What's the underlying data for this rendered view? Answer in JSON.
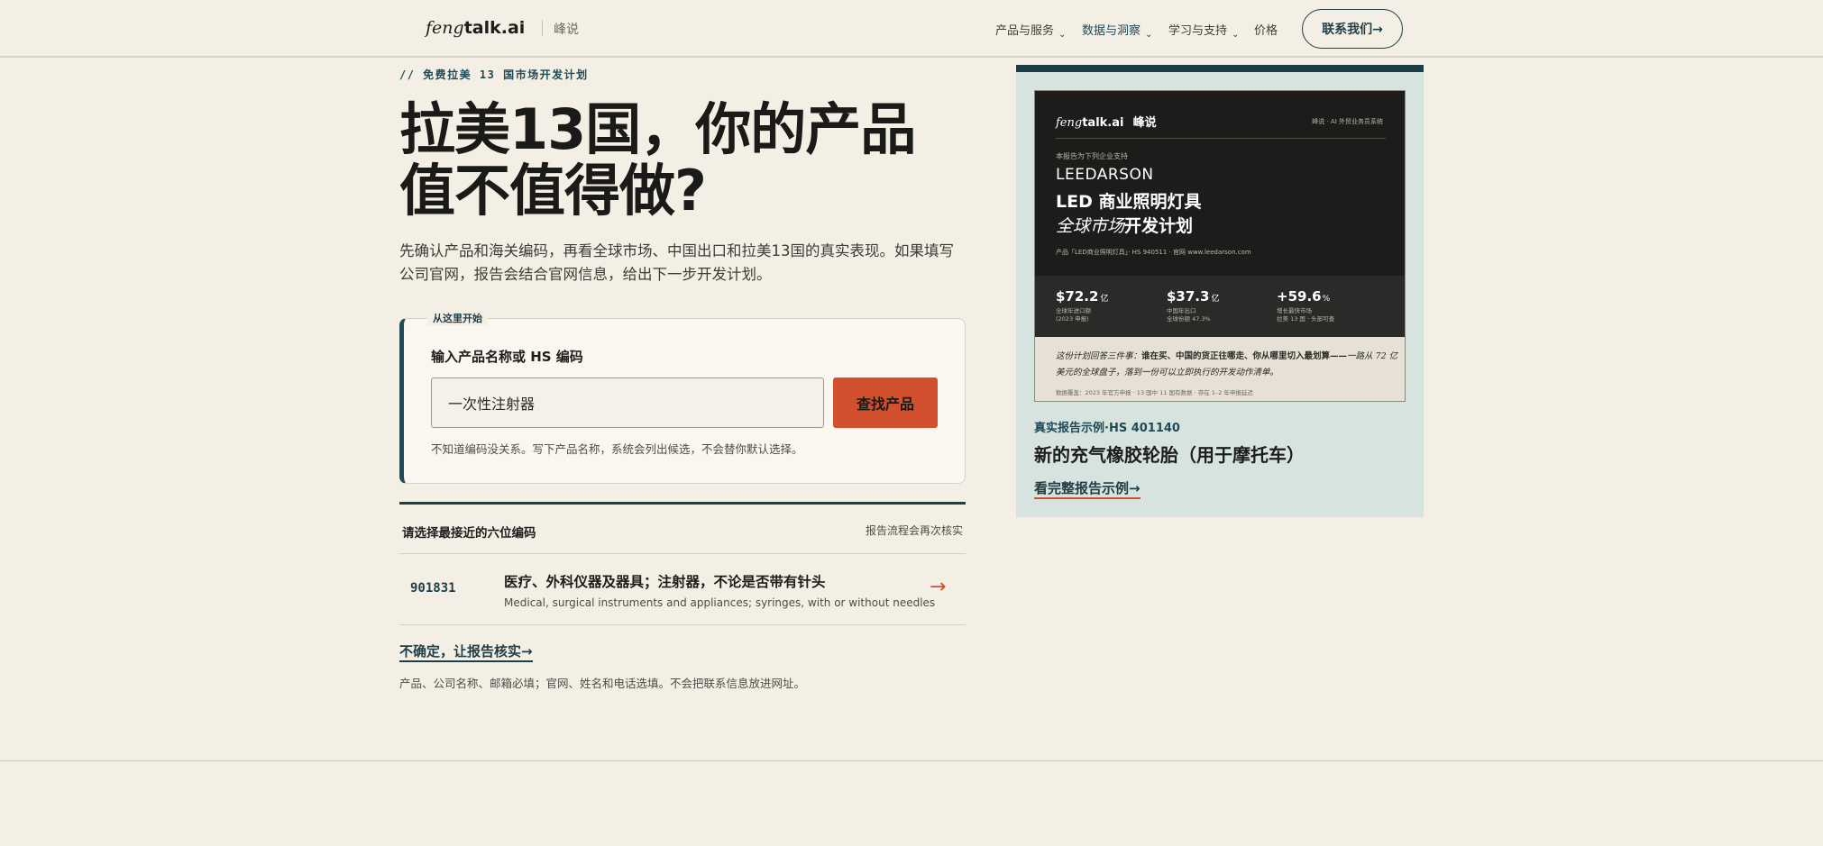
{
  "header": {
    "logo_italic": "feng",
    "logo_bold": "talk.ai",
    "logo_sub": "峰说",
    "nav": [
      {
        "label": "产品与服务",
        "chevron": "chevron-down-icon"
      },
      {
        "label": "数据与洞察",
        "chevron": "chevron-down-icon"
      },
      {
        "label": "学习与支持",
        "chevron": "chevron-down-icon"
      },
      {
        "label": "价格"
      }
    ],
    "contact_label": "联系我们→"
  },
  "hero": {
    "eyebrow": "// 免费拉美 13 国市场开发计划",
    "title_line1": "拉美13国，你的产品",
    "title_line2": "值不值得做?",
    "description": "先确认产品和海关编码，再看全球市场、中国出口和拉美13国的真实表现。如果填写公司官网，报告会结合官网信息，给出下一步开发计划。"
  },
  "search": {
    "tag": "从这里开始",
    "label": "输入产品名称或 HS 编码",
    "value": "一次性注射器",
    "button": "查找产品",
    "hint": "不知道编码没关系。写下产品名称，系统会列出候选，不会替你默认选择。"
  },
  "results": {
    "heading": "请选择最接近的六位编码",
    "note": "报告流程会再次核实",
    "rows": [
      {
        "code": "901831",
        "title_cn": "医疗、外科仪器及器具；注射器，不论是否带有针头",
        "title_en": "Medical, surgical instruments and appliances; syringes, with or without needles",
        "arrow": "→"
      }
    ],
    "verify_link": "不确定，让报告核实→",
    "footnote": "产品、公司名称、邮箱必填；官网、姓名和电话选填。不会把联系信息放进网址。"
  },
  "sample": {
    "cover": {
      "logo_italic": "feng",
      "logo_bold": "talk.ai",
      "logo_sub": "峰说",
      "tagline": "峰说 · AI 外贸业务员系统",
      "support": "本报告为下列企业支持",
      "brand": "LEEDARSON",
      "title_line1": "LED 商业照明灯具",
      "title_line2_italic": "全球市场",
      "title_line2_bold": "开发计划",
      "meta": "产品「LED商业照明灯具」· HS 940511 · 官网 www.leedarson.com",
      "stats": [
        {
          "value": "$72.2",
          "unit": "亿",
          "label1": "全球年进口额",
          "label2": "(2023 申报)"
        },
        {
          "value": "$37.3",
          "unit": "亿",
          "label1": "中国年出口",
          "label2": "全球份额 47.3%"
        },
        {
          "value": "+59.6",
          "unit": "%",
          "label1": "增长最快市场",
          "label2": "拉美 13 国 · 头部可查"
        }
      ],
      "quote_pre": "这份计划回答三件事：",
      "quote_bold": "谁在买、中国的货正往哪走、你从哪里切入最划算——",
      "quote_post": "一路从 72 亿美元的全球盘子，落到一份可以立即执行的开发动作清单。",
      "source": "数据覆盖：2023 年官方申报 · 13 国中 11 国有数据 · 存在 1–2 年申报延迟"
    },
    "kicker": "真实报告示例·HS 401140",
    "title": "新的充气橡胶轮胎（用于摩托车）",
    "link": "看完整报告示例→"
  },
  "colors": {
    "background": "#f4efe4",
    "accent_teal": "#1f3d47",
    "accent_orange": "#d2502e",
    "panel": "#d6e3df"
  }
}
